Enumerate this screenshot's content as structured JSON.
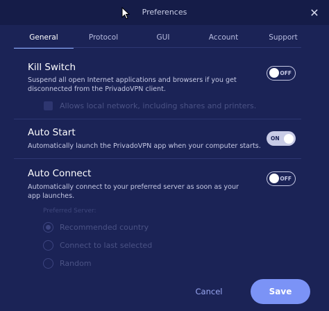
{
  "window": {
    "title": "Preferences",
    "close_icon": "close-icon",
    "close_glyph": "✕"
  },
  "tabs": [
    {
      "label": "General",
      "active": true
    },
    {
      "label": "Protocol",
      "active": false
    },
    {
      "label": "GUI",
      "active": false
    },
    {
      "label": "Account",
      "active": false
    },
    {
      "label": "Support",
      "active": false
    }
  ],
  "kill_switch": {
    "title": "Kill Switch",
    "description": "Suspend all open Internet applications and browsers if you get disconnected from the PrivadoVPN client.",
    "state": "OFF",
    "sub_option": {
      "label": "Allows local network, including shares and printers.",
      "checked": false,
      "enabled": false
    }
  },
  "auto_start": {
    "title": "Auto Start",
    "description": "Automatically launch the PrivadoVPN app when your computer starts.",
    "state": "ON"
  },
  "auto_connect": {
    "title": "Auto Connect",
    "description": "Automatically connect to your preferred server as soon as your app launches.",
    "state": "OFF",
    "preferred_server": {
      "label": "Preferred Server:",
      "options": [
        {
          "label": "Recommended country",
          "selected": true
        },
        {
          "label": "Connect to last selected",
          "selected": false
        },
        {
          "label": "Random",
          "selected": false
        }
      ],
      "enabled": false
    }
  },
  "footer": {
    "cancel_label": "Cancel",
    "save_label": "Save"
  },
  "colors": {
    "background": "#1b2356",
    "accent": "#7b93f6",
    "disabled": "#4b5385"
  }
}
